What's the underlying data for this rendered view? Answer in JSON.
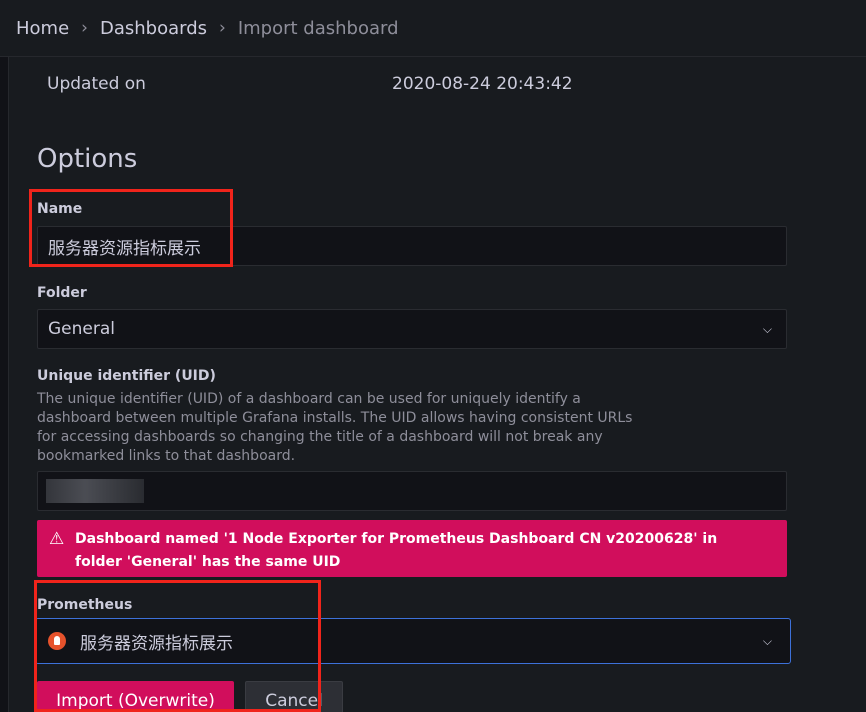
{
  "breadcrumb": {
    "home": "Home",
    "dashboards": "Dashboards",
    "current": "Import dashboard",
    "separator": "›"
  },
  "info": {
    "updated_label": "Updated on",
    "updated_value": "2020-08-24 20:43:42"
  },
  "options": {
    "title": "Options",
    "name": {
      "label": "Name",
      "value": "服务器资源指标展示"
    },
    "folder": {
      "label": "Folder",
      "value": "General"
    },
    "uid": {
      "label": "Unique identifier (UID)",
      "description": "The unique identifier (UID) of a dashboard can be used for uniquely identify a dashboard between multiple Grafana installs. The UID allows having consistent URLs for accessing dashboards so changing the title of a dashboard will not break any bookmarked links to that dashboard."
    },
    "alert": {
      "icon": "warning-triangle-icon",
      "text": "Dashboard named '1 Node Exporter for Prometheus Dashboard CN v20200628' in folder 'General' has the same UID"
    },
    "prometheus": {
      "label": "Prometheus",
      "value": "服务器资源指标展示",
      "icon": "prometheus-icon"
    }
  },
  "buttons": {
    "import": "Import (Overwrite)",
    "cancel": "Cancel"
  },
  "colors": {
    "primary": "#d10e5c",
    "focus_border": "#3d71d9",
    "annotation_red": "#f0241b"
  }
}
